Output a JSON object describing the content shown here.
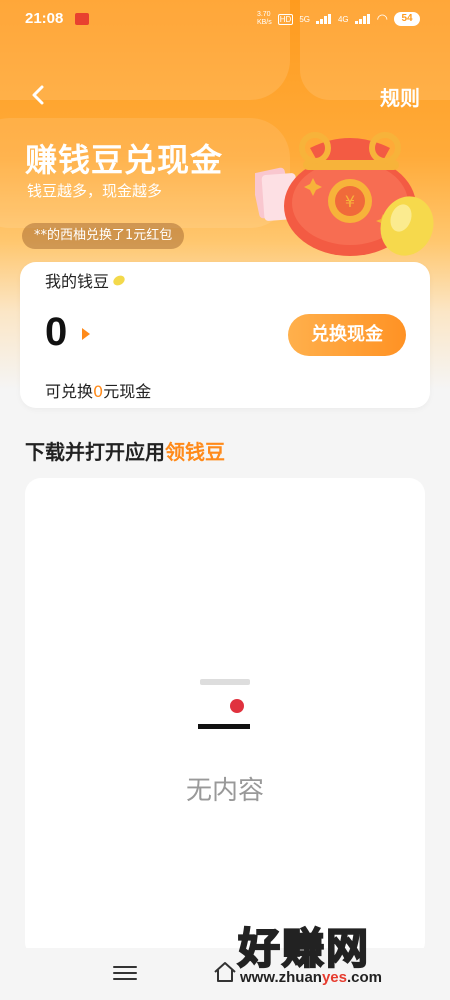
{
  "status_bar": {
    "time": "21:08",
    "net_speed": "3.70\nKB/s",
    "signal1": "5G",
    "signal2": "4G",
    "battery": "54"
  },
  "header": {
    "rules_label": "规则"
  },
  "hero": {
    "title": "赚钱豆兑现金",
    "subtitle": "钱豆越多，现金越多",
    "ticker": "**的西柚兑换了1元红包"
  },
  "balance_card": {
    "label": "我的钱豆",
    "balance": "0",
    "exchange_button": "兑换现金",
    "redeemable_prefix": "可兑换",
    "redeemable_amount": "0",
    "redeemable_suffix": "元现金"
  },
  "section": {
    "title_prefix": "下载并打开应用",
    "title_highlight": "领钱豆"
  },
  "empty_state": {
    "text": "无内容"
  },
  "watermark": {
    "big": "好赚网",
    "small_prefix": "www.zhuan",
    "small_highlight": "yes",
    "small_suffix": ".com"
  },
  "colors": {
    "accent": "#ff8a1a",
    "hero_top": "#ff9b1e",
    "empty_dot": "#e0323e"
  }
}
